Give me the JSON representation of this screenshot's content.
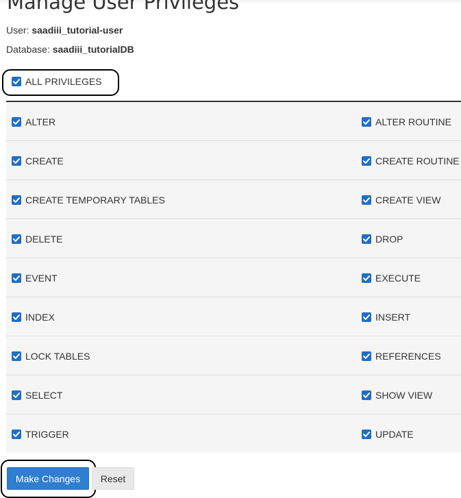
{
  "page": {
    "title": "Manage User Privileges"
  },
  "meta": {
    "user_label": "User:",
    "user_value": "saadiii_tutorial-user",
    "database_label": "Database:",
    "database_value": "saadiii_tutorialDB"
  },
  "all_privileges": {
    "label": "ALL PRIVILEGES",
    "checked": true
  },
  "privileges": [
    {
      "left": "ALTER",
      "right": "ALTER ROUTINE"
    },
    {
      "left": "CREATE",
      "right": "CREATE ROUTINE"
    },
    {
      "left": "CREATE TEMPORARY TABLES",
      "right": "CREATE VIEW"
    },
    {
      "left": "DELETE",
      "right": "DROP"
    },
    {
      "left": "EVENT",
      "right": "EXECUTE"
    },
    {
      "left": "INDEX",
      "right": "INSERT"
    },
    {
      "left": "LOCK TABLES",
      "right": "REFERENCES"
    },
    {
      "left": "SELECT",
      "right": "SHOW VIEW"
    },
    {
      "left": "TRIGGER",
      "right": "UPDATE"
    }
  ],
  "actions": {
    "make_changes_label": "Make Changes",
    "reset_label": "Reset"
  },
  "colors": {
    "checkbox": "#1f6fc5",
    "primary_button": "#2f7ecf",
    "row_background": "#f5f5f5"
  },
  "icons": {
    "checkbox": "checkmark-icon"
  }
}
